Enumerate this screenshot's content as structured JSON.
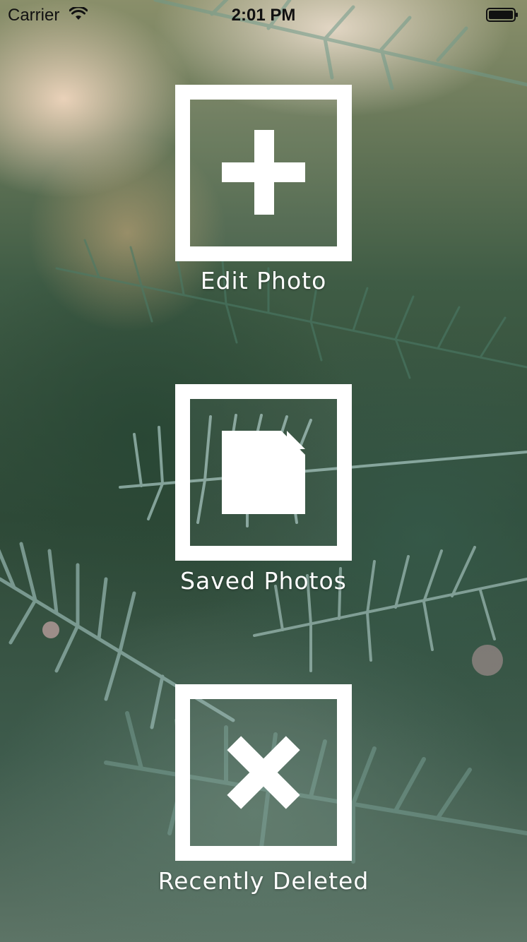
{
  "status_bar": {
    "carrier": "Carrier",
    "time": "2:01 PM",
    "wifi_icon": "wifi-icon",
    "battery_icon": "battery-icon"
  },
  "menu": {
    "edit_photo": {
      "label": "Edit Photo",
      "icon": "plus-icon"
    },
    "saved_photos": {
      "label": "Saved Photos",
      "icon": "document-icon"
    },
    "recently_deleted": {
      "label": "Recently Deleted",
      "icon": "x-icon"
    }
  },
  "colors": {
    "tile": "#FFFFFF",
    "label": "#FFFFFF",
    "status_text": "#111111"
  }
}
